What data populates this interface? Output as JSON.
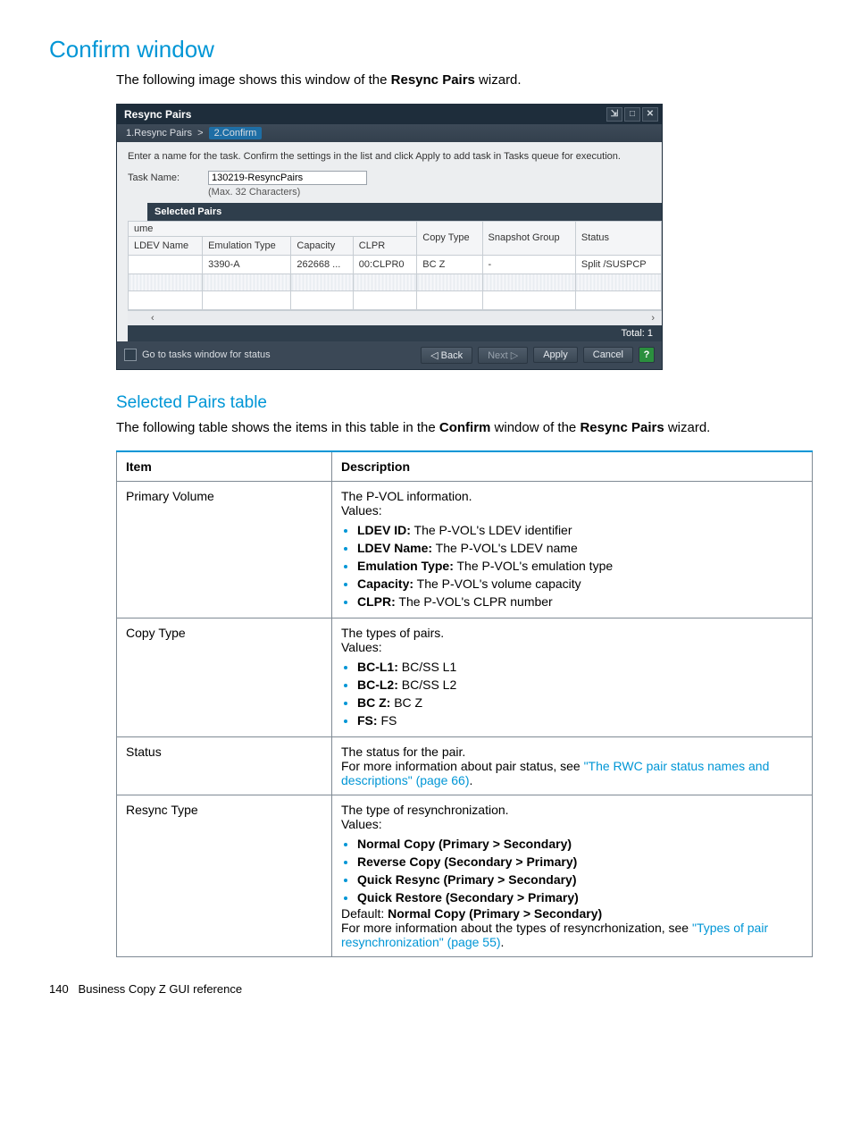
{
  "page": {
    "title": "Confirm window",
    "intro_pre": "The following image shows this window of the ",
    "intro_bold": "Resync Pairs",
    "intro_post": " wizard."
  },
  "wizard": {
    "title": "Resync Pairs",
    "crumb1": "1.Resync Pairs",
    "crumb2": "2.Confirm",
    "hint": "Enter a name for the task. Confirm the settings in the list and click Apply to add task in Tasks queue for execution.",
    "task_label": "Task Name:",
    "task_value": "130219-ResyncPairs",
    "max_chars": "(Max. 32 Characters)",
    "selected_pairs": "Selected Pairs",
    "ume": "ume",
    "cols": {
      "ldev": "LDEV Name",
      "emul": "Emulation Type",
      "cap": "Capacity",
      "clpr": "CLPR",
      "copy": "Copy Type",
      "snap": "Snapshot Group",
      "status": "Status"
    },
    "row": {
      "ldev": "",
      "emul": "3390-A",
      "cap": "262668 ...",
      "clpr": "00:CLPR0",
      "copy": "BC Z",
      "snap": "-",
      "status": "Split /SUSPCP"
    },
    "total": "Total:  1",
    "go_tasks": "Go to tasks window for status",
    "btn_back": "◁ Back",
    "btn_next": "Next ▷",
    "btn_apply": "Apply",
    "btn_cancel": "Cancel"
  },
  "section2": {
    "heading": "Selected Pairs table",
    "intro_pre": "The following table shows the items in this table in the ",
    "intro_b1": "Confirm",
    "intro_mid": " window of the ",
    "intro_b2": "Resync Pairs",
    "intro_post": " wizard."
  },
  "spec": {
    "head_item": "Item",
    "head_desc": "Description",
    "r1": {
      "item": "Primary Volume",
      "l1": "The P-VOL information.",
      "l2": "Values:",
      "bi1b": "LDEV ID:",
      "bi1t": " The P-VOL's LDEV identifier",
      "bi2b": "LDEV Name:",
      "bi2t": " The P-VOL's LDEV name",
      "bi3b": "Emulation Type:",
      "bi3t": " The P-VOL's emulation type",
      "bi4b": "Capacity:",
      "bi4t": " The P-VOL's volume capacity",
      "bi5b": "CLPR:",
      "bi5t": " The P-VOL's CLPR number"
    },
    "r2": {
      "item": "Copy Type",
      "l1": "The types of pairs.",
      "l2": "Values:",
      "bi1b": "BC-L1:",
      "bi1t": " BC/SS L1",
      "bi2b": "BC-L2:",
      "bi2t": " BC/SS L2",
      "bi3b": "BC Z:",
      "bi3t": " BC Z",
      "bi4b": "FS:",
      "bi4t": " FS"
    },
    "r3": {
      "item": "Status",
      "l1": "The status for the pair.",
      "l2a": "For more information about pair status, see ",
      "l2link": "\"The RWC pair status names and descriptions\" (page 66)",
      "l2b": "."
    },
    "r4": {
      "item": "Resync Type",
      "l1": "The type of resynchronization.",
      "l2": "Values:",
      "bi1": "Normal Copy (Primary > Secondary)",
      "bi2": "Reverse Copy (Secondary > Primary)",
      "bi3": "Quick Resync (Primary > Secondary)",
      "bi4": "Quick Restore (Secondary > Primary)",
      "def_a": "Default: ",
      "def_b": "Normal Copy (Primary > Secondary)",
      "more_a": "For more information about the types of resyncrhonization, see ",
      "more_link": "\"Types of pair resynchronization\" (page 55)",
      "more_b": "."
    }
  },
  "footer": {
    "num": "140",
    "txt": "Business Copy Z GUI reference"
  }
}
